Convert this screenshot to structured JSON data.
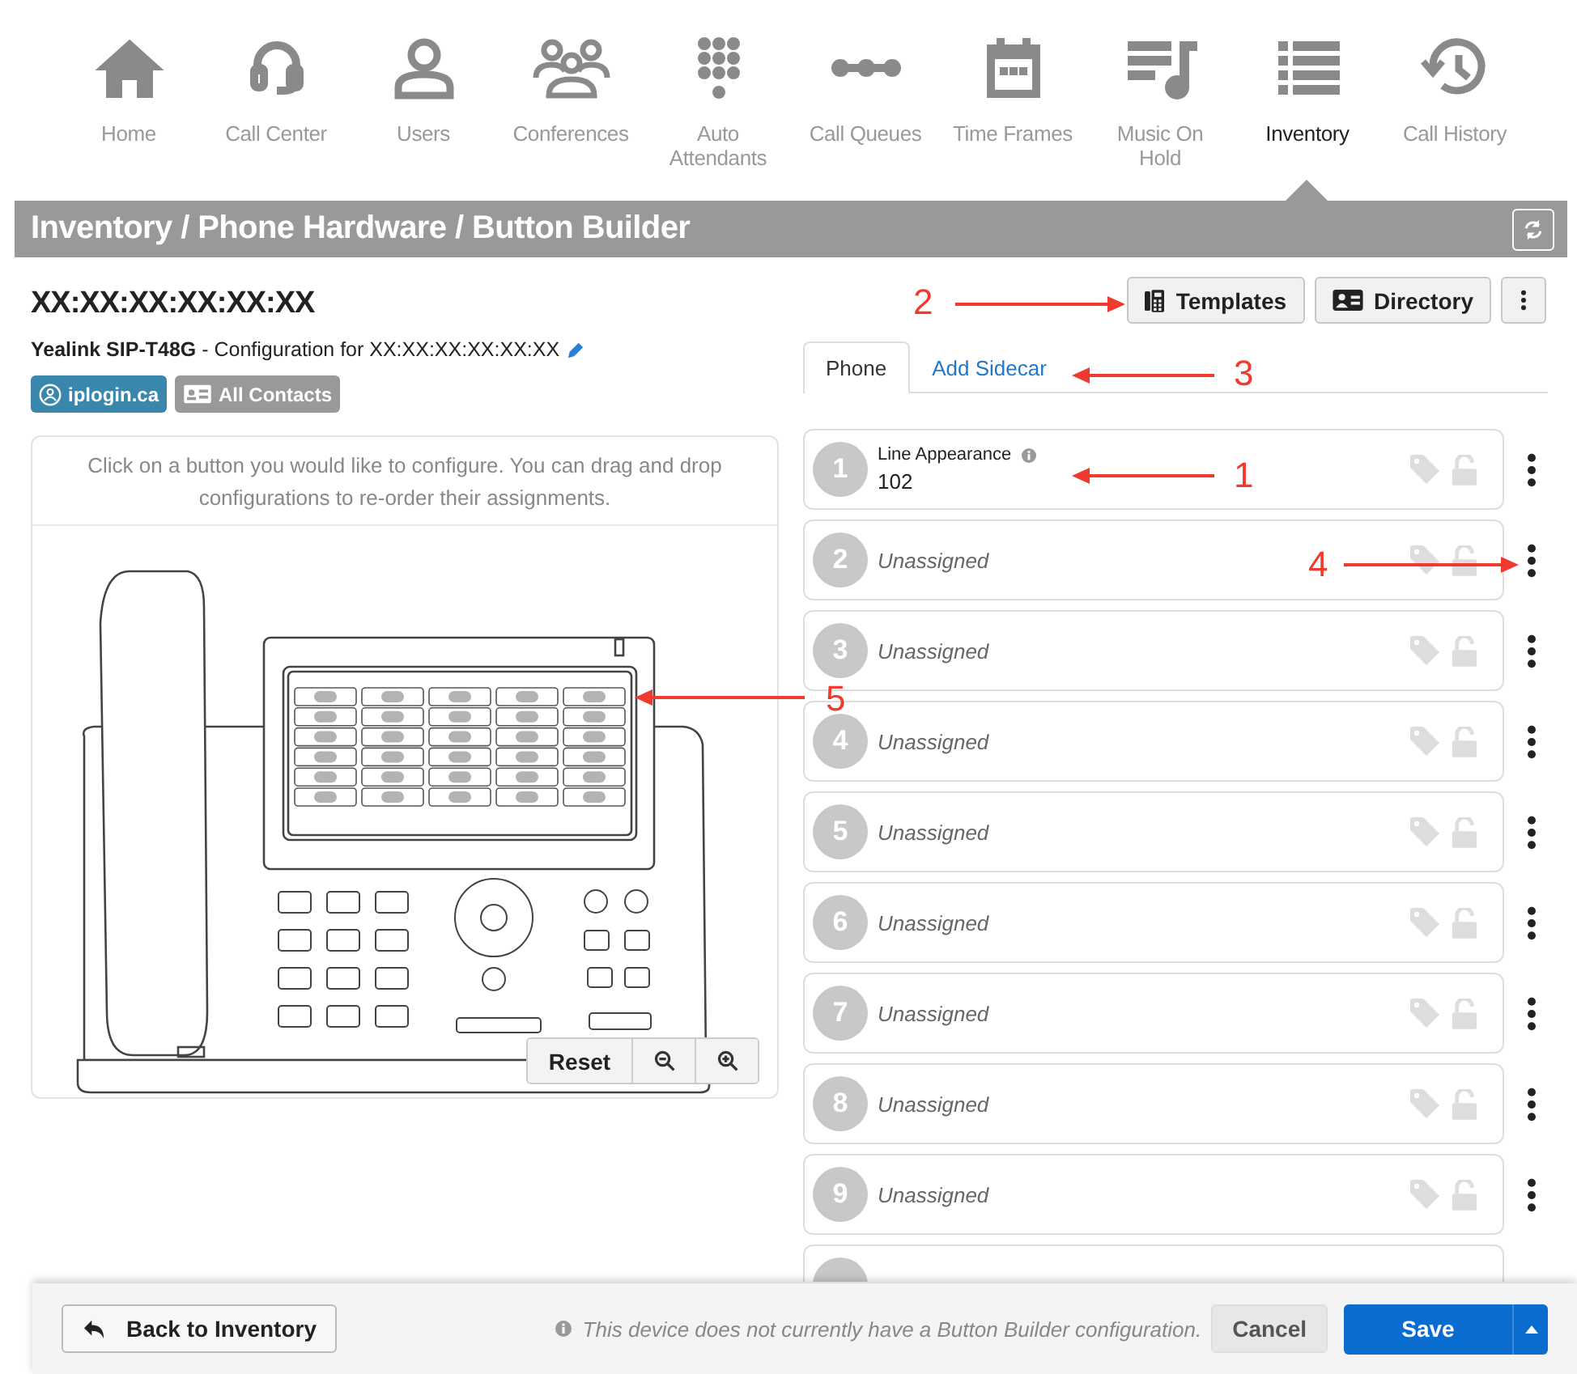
{
  "nav": {
    "items": [
      {
        "label": "Home",
        "selected": false
      },
      {
        "label": "Call Center",
        "selected": false
      },
      {
        "label": "Users",
        "selected": false
      },
      {
        "label": "Conferences",
        "selected": false
      },
      {
        "label": "Auto Attendants",
        "selected": false
      },
      {
        "label": "Call Queues",
        "selected": false
      },
      {
        "label": "Time Frames",
        "selected": false
      },
      {
        "label": "Music On Hold",
        "selected": false
      },
      {
        "label": "Inventory",
        "selected": true
      },
      {
        "label": "Call History",
        "selected": false
      }
    ]
  },
  "breadcrumb": "Inventory / Phone Hardware / Button Builder",
  "device": {
    "title": "XX:XX:XX:XX:XX:XX",
    "subtitle": "**Yealink SIP-T48G** - Configuration for XX:XX:XX:XX:XX:XX",
    "tags": [
      {
        "label": "iplogin.ca",
        "color": "#3a87ad"
      },
      {
        "label": "All Contacts",
        "color": "#999999"
      }
    ]
  },
  "toolbar": {
    "buttons": [
      "Templates",
      "Directory"
    ]
  },
  "tabs": [
    {
      "label": "Phone",
      "selected": true
    },
    {
      "label": "Add Sidecar",
      "selected": false
    }
  ],
  "panel": {
    "hint": "Click on a button you would like to configure. You can drag and drop configurations to re-order their assignments.",
    "reset": "Reset"
  },
  "rows": [
    {
      "number": "1",
      "kind": "assigned",
      "label": "Line Appearance",
      "value": "102"
    },
    {
      "number": "2",
      "kind": "unassigned",
      "value": "Unassigned"
    },
    {
      "number": "3",
      "kind": "unassigned",
      "value": "Unassigned"
    },
    {
      "number": "4",
      "kind": "unassigned",
      "value": "Unassigned"
    },
    {
      "number": "5",
      "kind": "unassigned",
      "value": "Unassigned"
    },
    {
      "number": "6",
      "kind": "unassigned",
      "value": "Unassigned"
    },
    {
      "number": "7",
      "kind": "unassigned",
      "value": "Unassigned"
    },
    {
      "number": "8",
      "kind": "unassigned",
      "value": "Unassigned"
    },
    {
      "number": "9",
      "kind": "unassigned",
      "value": "Unassigned"
    }
  ],
  "footer": {
    "back": "Back to Inventory",
    "note": "This device does not currently have a Button Builder configuration.",
    "cancel": "Cancel",
    "save": "Save"
  },
  "annotations": [
    {
      "label": "1"
    },
    {
      "label": "2"
    },
    {
      "label": "3"
    },
    {
      "label": "4"
    },
    {
      "label": "5"
    }
  ]
}
